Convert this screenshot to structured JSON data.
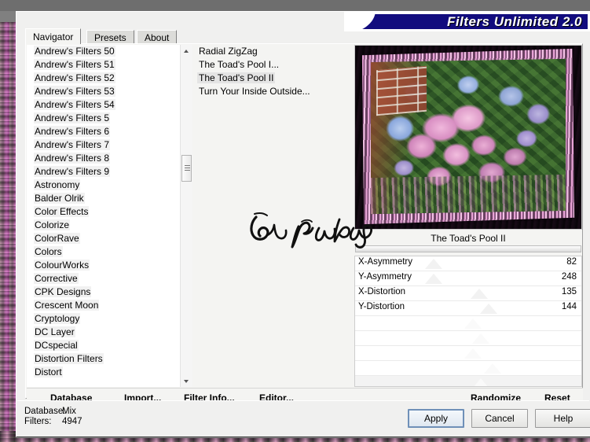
{
  "window": {
    "title": "Filters Unlimited 2.0"
  },
  "tabs": [
    {
      "label": "Navigator",
      "active": true
    },
    {
      "label": "Presets",
      "active": false
    },
    {
      "label": "About",
      "active": false
    }
  ],
  "categories": {
    "items": [
      "Andrew's Filters 50",
      "Andrew's Filters 51",
      "Andrew's Filters 52",
      "Andrew's Filters 53",
      "Andrew's Filters 54",
      "Andrew's Filters 5",
      "Andrew's Filters 6",
      "Andrew's Filters 7",
      "Andrew's Filters 8",
      "Andrew's Filters 9",
      "Astronomy",
      "Balder Olrik",
      "Color Effects",
      "Colorize",
      "ColorRave",
      "Colors",
      "ColourWorks",
      "Corrective",
      "CPK Designs",
      "Crescent Moon",
      "Cryptology",
      "DC Layer",
      "DCspecial",
      "Distortion Filters",
      "Distort"
    ]
  },
  "filters": {
    "items": [
      {
        "label": "Radial ZigZag",
        "selected": false
      },
      {
        "label": "The Toad's Pool I...",
        "selected": false
      },
      {
        "label": "The Toad's Pool II",
        "selected": true
      },
      {
        "label": "Turn Your Inside Outside...",
        "selected": false
      }
    ]
  },
  "preview": {
    "title": "The Toad's Pool II",
    "signature": "by pinda"
  },
  "parameters": [
    {
      "name": "X-Asymmetry",
      "value": "82",
      "pos": 100
    },
    {
      "name": "Y-Asymmetry",
      "value": "248",
      "pos": 100
    },
    {
      "name": "X-Distortion",
      "value": "135",
      "pos": 158
    },
    {
      "name": "Y-Distortion",
      "value": "144",
      "pos": 170
    }
  ],
  "actions": {
    "database": {
      "mnemonic": "D",
      "rest": "atabase"
    },
    "import": {
      "pre": "I",
      "mnemonic": "m",
      "rest": "port..."
    },
    "filter_info": {
      "pre": "Filter ",
      "mnemonic": "I",
      "rest": "nfo..."
    },
    "editor": {
      "mnemonic": "E",
      "rest": "ditor..."
    },
    "randomize": "Randomize",
    "reset": "Reset"
  },
  "status": {
    "database_key": "Database:",
    "database_value": "Mix",
    "filters_key": "Filters:",
    "filters_value": "4947"
  },
  "buttons": {
    "apply": "Apply",
    "cancel": "Cancel",
    "help": "Help"
  },
  "colors": {
    "banner": "#120c7e",
    "banner_text": "#ffffff",
    "dialog_bg": "#f0f0ef",
    "panel_bg": "#f4f4f2",
    "list_bg": "#ffffff",
    "default_button_border": "#6f90b8"
  }
}
